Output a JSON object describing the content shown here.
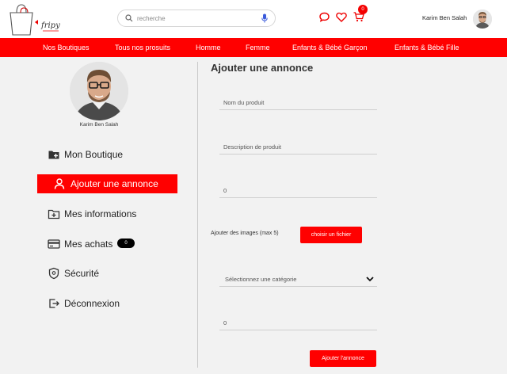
{
  "header": {
    "logo_text": "fripy",
    "search": {
      "placeholder": "recherche",
      "value": ""
    },
    "cart_count": "0",
    "user_name": "Karim Ben Salah"
  },
  "nav": {
    "items": [
      "Nos Boutiques",
      "Tous nos prosuits",
      "Homme",
      "Femme",
      "Enfants & Bébé Garçon",
      "Enfants & Bébé Fille"
    ]
  },
  "sidebar": {
    "profile_name": "Karim Ben Salah",
    "items": [
      {
        "label": "Mon Boutique",
        "icon": "folder-plus-icon"
      },
      {
        "label": "Ajouter une annonce",
        "icon": "user-icon",
        "active": true
      },
      {
        "label": "Mes informations",
        "icon": "folder-add-icon"
      },
      {
        "label": "Mes achats",
        "icon": "credit-card-icon",
        "badge": "0"
      },
      {
        "label": "Sécurité",
        "icon": "shield-icon"
      },
      {
        "label": "Déconnexion",
        "icon": "logout-icon"
      }
    ]
  },
  "form": {
    "title": "Ajouter une annonce",
    "product_name_placeholder": "Nom du produit",
    "description_placeholder": "Description de produit",
    "price_value": "0",
    "images_label": "Ajouter des images (max 5)",
    "choose_file_label": "choisir un fichier",
    "category_placeholder": "Sélectionnez une catégorie",
    "quantity_value": "0",
    "submit_label": "Ajouter l'annonce"
  },
  "colors": {
    "accent": "#ff0000",
    "badge_dark": "#000000"
  }
}
